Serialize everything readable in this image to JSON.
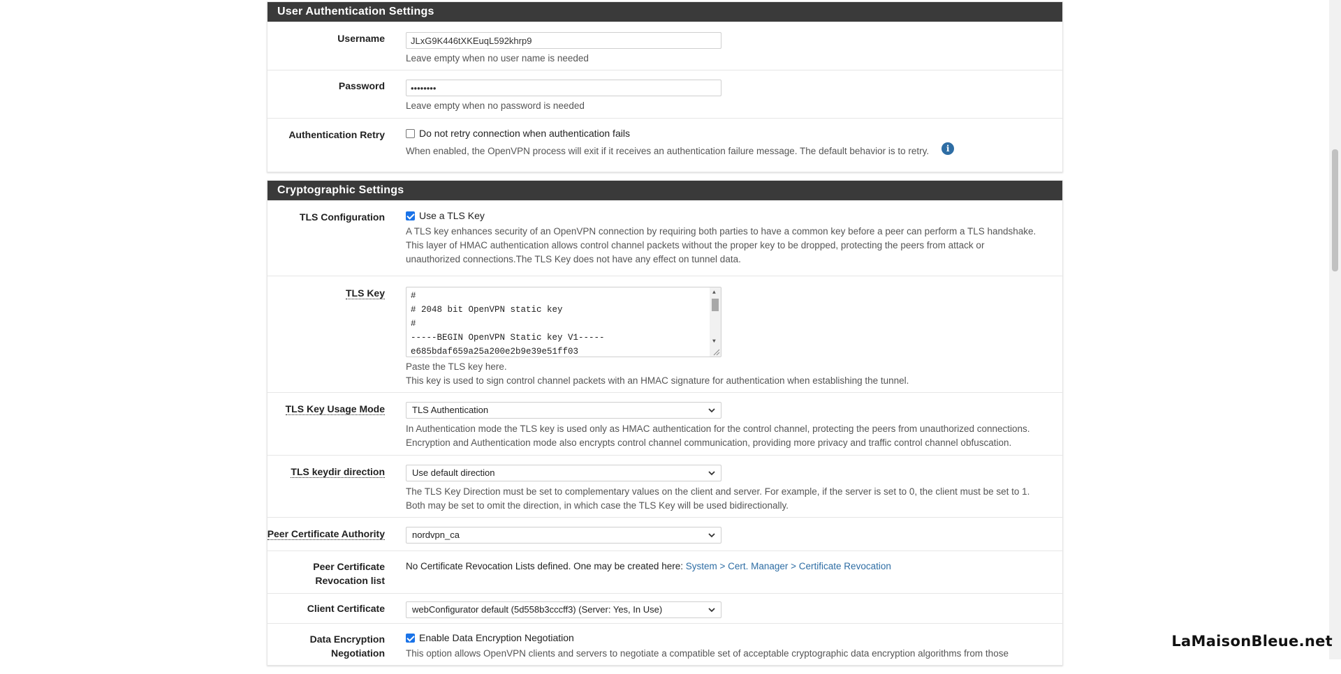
{
  "user_auth": {
    "heading": "User Authentication Settings",
    "username": {
      "label": "Username",
      "value": "JLxG9K446tXKEuqL592khrp9",
      "help": "Leave empty when no user name is needed"
    },
    "password": {
      "label": "Password",
      "value": "••••••••",
      "help": "Leave empty when no password is needed"
    },
    "auth_retry": {
      "label": "Authentication Retry",
      "checkbox_label": "Do not retry connection when authentication fails",
      "checked": false,
      "help": "When enabled, the OpenVPN process will exit if it receives an authentication failure message. The default behavior is to retry."
    }
  },
  "crypto": {
    "heading": "Cryptographic Settings",
    "tls_config": {
      "label": "TLS Configuration",
      "checkbox_label": "Use a TLS Key",
      "checked": true,
      "help1": "A TLS key enhances security of an OpenVPN connection by requiring both parties to have a common key before a peer can perform a TLS handshake.",
      "help2": "This layer of HMAC authentication allows control channel packets without the proper key to be dropped, protecting the peers from attack or",
      "help3": "unauthorized connections.The TLS Key does not have any effect on tunnel data."
    },
    "tls_key": {
      "label": "TLS Key",
      "lines": [
        "#",
        "# 2048 bit OpenVPN static key",
        "#",
        "-----BEGIN OpenVPN Static key V1-----",
        "e685bdaf659a25a200e2b9e39e51ff03"
      ],
      "help1": "Paste the TLS key here.",
      "help2": "This key is used to sign control channel packets with an HMAC signature for authentication when establishing the tunnel."
    },
    "tls_usage": {
      "label": "TLS Key Usage Mode",
      "selected": "TLS Authentication",
      "help1": "In Authentication mode the TLS key is used only as HMAC authentication for the control channel, protecting the peers from unauthorized connections.",
      "help2": "Encryption and Authentication mode also encrypts control channel communication, providing more privacy and traffic control channel obfuscation."
    },
    "tls_keydir": {
      "label": "TLS keydir direction",
      "selected": "Use default direction",
      "help1": "The TLS Key Direction must be set to complementary values on the client and server. For example, if the server is set to 0, the client must be set to 1.",
      "help2": "Both may be set to omit the direction, in which case the TLS Key will be used bidirectionally."
    },
    "peer_ca": {
      "label": "Peer Certificate Authority",
      "selected": "nordvpn_ca"
    },
    "peer_crl": {
      "label1": "Peer Certificate",
      "label2": "Revocation list",
      "text": "No Certificate Revocation Lists defined. One may be created here: ",
      "link": "System > Cert. Manager > Certificate Revocation"
    },
    "client_cert": {
      "label": "Client Certificate",
      "selected": "webConfigurator default (5d558b3cccff3) (Server: Yes, In Use)"
    },
    "data_enc": {
      "label1": "Data Encryption",
      "label2": "Negotiation",
      "checkbox_label": "Enable Data Encryption Negotiation",
      "checked": true,
      "help": "This option allows OpenVPN clients and servers to negotiate a compatible set of acceptable cryptographic data encryption algorithms from those"
    }
  },
  "watermark": "LaMaisonBleue.net"
}
